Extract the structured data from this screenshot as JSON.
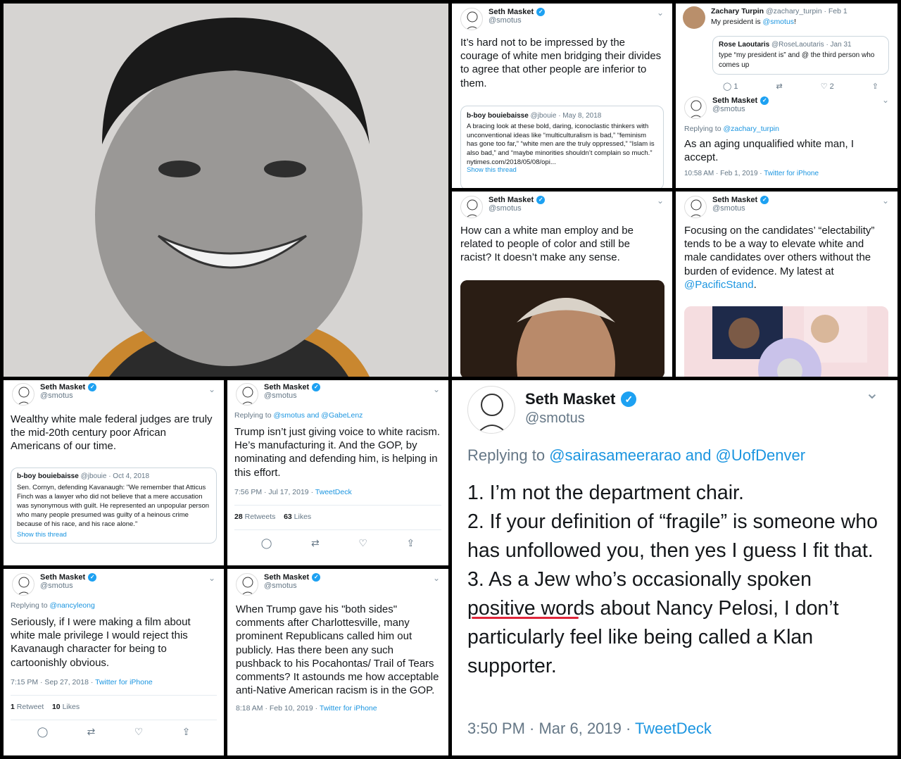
{
  "p2": {
    "name": "Seth Masket",
    "handle": "@smotus",
    "text": "It’s hard not to be impressed by the courage of white men bridging their divides to agree that other people are inferior to them.",
    "quote": {
      "name": "b-boy bouiebaisse",
      "handle": "@jbouie",
      "date": "· May 8, 2018",
      "text": "A bracing look at these bold, daring, iconoclastic thinkers with unconventional ideas like “multiculturalism is bad,” “feminism has gone too far,” “white men are the truly oppressed,” “Islam is also bad,” and “maybe minorities shouldn’t complain so much.”",
      "url": "nytimes.com/2018/05/08/opi...",
      "thread": "Show this thread"
    }
  },
  "p3": {
    "parent": {
      "name": "Zachary Turpin",
      "handle": "@zachary_turpin",
      "date": "· Feb 1",
      "text_prefix": "My president is ",
      "mention": "@smotus",
      "text_suffix": "!"
    },
    "quote": {
      "name": "Rose Laoutaris",
      "handle": "@RoseLaoutaris",
      "date": "· Jan 31",
      "text": "type “my president is” and @ the third person who comes up"
    },
    "actions": {
      "reply": "1",
      "retweet": "",
      "like": "2"
    },
    "reply": {
      "name": "Seth Masket",
      "handle": "@smotus",
      "replying": "Replying to",
      "replying_to": "@zachary_turpin",
      "text": "As an aging unqualified white man, I accept.",
      "meta": "10:58 AM · Feb 1, 2019 ·",
      "source": "Twitter for iPhone"
    }
  },
  "p4": {
    "name": "Seth Masket",
    "handle": "@smotus",
    "text": "How can a white man employ and be related to people of color and still be racist? It doesn’t make any sense."
  },
  "p5": {
    "name": "Seth Masket",
    "handle": "@smotus",
    "text": "Focusing on the candidates’ “electability” tends to be a way to elevate white and male candidates over others without the burden of evidence. My latest at ",
    "mention": "@PacificStand",
    "after": "."
  },
  "p6": {
    "name": "Seth Masket",
    "handle": "@smotus",
    "text": "Wealthy white male federal judges are truly the mid-20th century poor African Americans of our time.",
    "quote": {
      "name": "b-boy bouiebaisse",
      "handle": "@jbouie",
      "date": "· Oct 4, 2018",
      "text": "Sen. Cornyn, defending Kavanaugh: \"We remember that Atticus Finch was a lawyer who did not believe that a mere accusation was synonymous with guilt. He represented an unpopular person who many people presumed was guilty of a heinous crime because of his race, and his race alone.\"",
      "thread": "Show this thread"
    }
  },
  "p7": {
    "name": "Seth Masket",
    "handle": "@smotus",
    "replying": "Replying to",
    "replying_to": "@smotus and @GabeLenz",
    "text": "Trump isn’t just giving voice to white racism. He’s manufacturing it. And the GOP, by nominating and defending him, is helping in this effort.",
    "meta": "7:56 PM · Jul 17, 2019 ·",
    "source": "TweetDeck",
    "retweets": "28",
    "retweets_label": "Retweets",
    "likes": "63",
    "likes_label": "Likes"
  },
  "p8": {
    "name": "Seth Masket",
    "handle": "@smotus",
    "replying": "Replying to",
    "replying_to": "@sairasameerarao and @UofDenver",
    "lines": [
      "1. I’m not the department chair.",
      "2. If your definition of “fragile” is someone who has unfollowed you, then yes I guess I fit that.",
      "3. As a Jew who’s occasionally spoken positive words about Nancy Pelosi, I don’t particularly feel like being called a Klan supporter."
    ],
    "meta": "3:50 PM · Mar 6, 2019 ·",
    "source": "TweetDeck"
  },
  "p9": {
    "name": "Seth Masket",
    "handle": "@smotus",
    "replying": "Replying to",
    "replying_to": "@nancyleong",
    "text": "Seriously, if I were making a film about white male privilege I would reject this Kavanaugh character for being to cartoonishly obvious.",
    "meta": "7:15 PM · Sep 27, 2018 ·",
    "source": "Twitter for iPhone",
    "retweets": "1",
    "retweets_label": "Retweet",
    "likes": "10",
    "likes_label": "Likes"
  },
  "p10": {
    "name": "Seth Masket",
    "handle": "@smotus",
    "text": "When Trump gave his \"both sides\" comments after Charlottesville, many prominent Republicans called him out publicly. Has there been any such pushback to his Pocahontas/ Trail of Tears comments? It astounds me how acceptable anti-Native American racism is in the GOP.",
    "meta": "8:18 AM · Feb 10, 2019 ·",
    "source": "Twitter for iPhone"
  },
  "icons": {
    "verified": "✓",
    "chevron": "⌄",
    "reply": "◯",
    "retweet": "⇄",
    "like": "♡",
    "share": "⇪"
  }
}
